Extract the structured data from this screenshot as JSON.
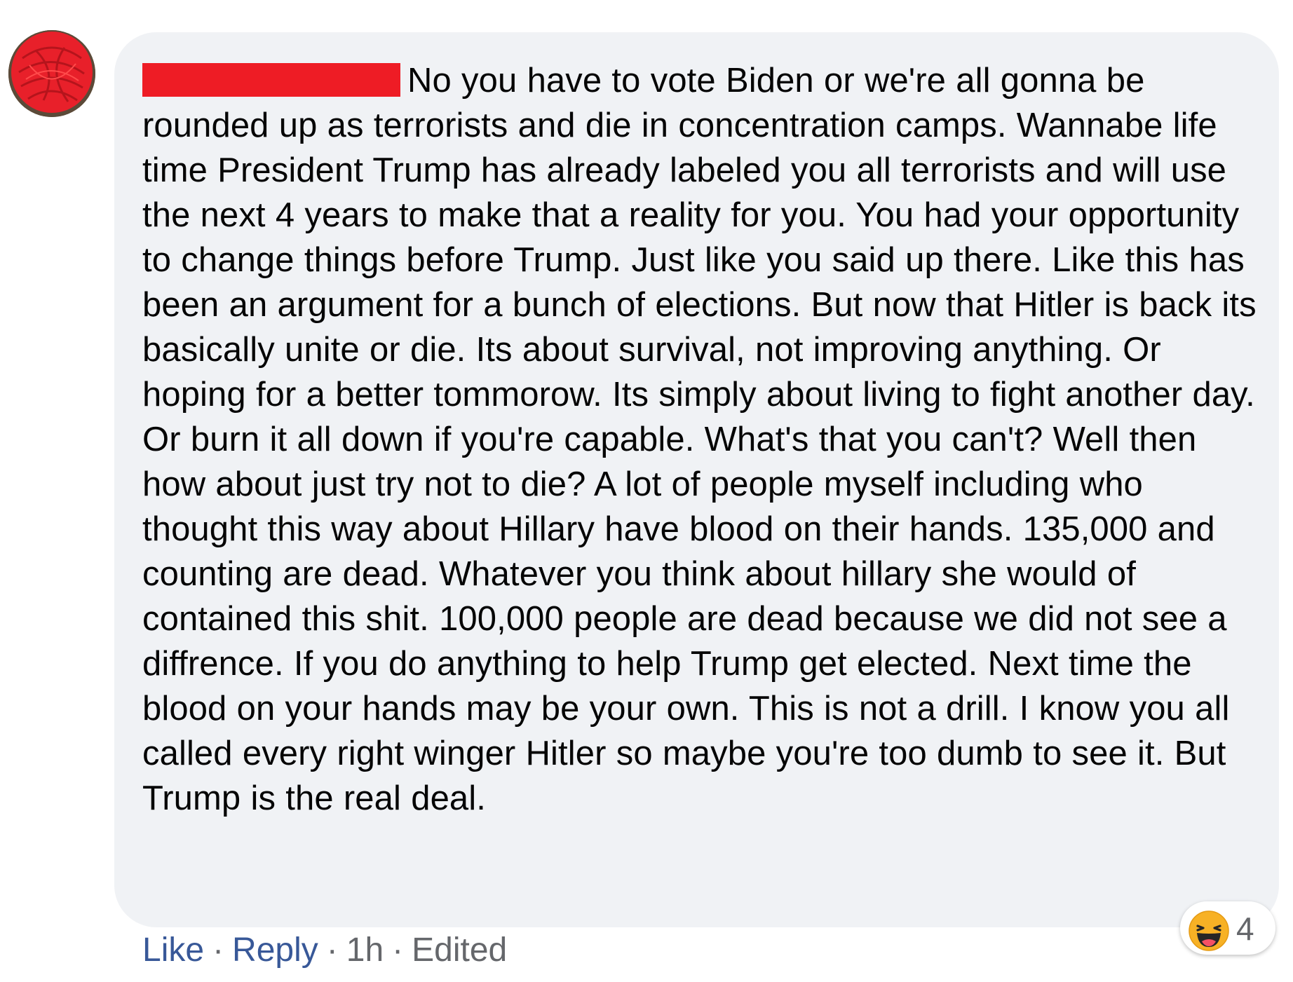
{
  "comment": {
    "author_name": "",
    "text": "No you have to vote Biden or we're all gonna be rounded up as terrorists and die in concentration camps. Wannabe life time President Trump has already labeled you all terrorists and will use the next 4 years to make that a reality for you. You had your opportunity to change things before Trump. Just like you said up there. Like this has been an argument for a bunch of elections. But now that Hitler is back its basically unite or die. Its about survival, not improving anything. Or hoping for a better tommorow. Its simply about living to fight another day. Or burn it all down if you're capable. What's that you can't? Well then how about just try not to die? A lot of people myself including who thought this way about Hillary have blood on their hands. 135,000 and counting are dead. Whatever you think about hillary she would of contained this shit. 100,000 people are dead because we did not see a diffrence. If you do anything to help Trump get elected. Next time the blood on your hands may be your own. This is not a drill. I know you all called every right winger Hitler so maybe you're too dumb to see it. But Trump is the real deal."
  },
  "actions": {
    "like_label": "Like",
    "reply_label": "Reply",
    "timestamp": "1h",
    "edited_label": "Edited",
    "separator": "·"
  },
  "reactions": {
    "icon": "haha-emoji-icon",
    "count": "4"
  },
  "colors": {
    "bubble_bg": "#f0f2f5",
    "text": "#050505",
    "link": "#385898",
    "meta": "#65676b",
    "redaction": "#ee1c25"
  }
}
